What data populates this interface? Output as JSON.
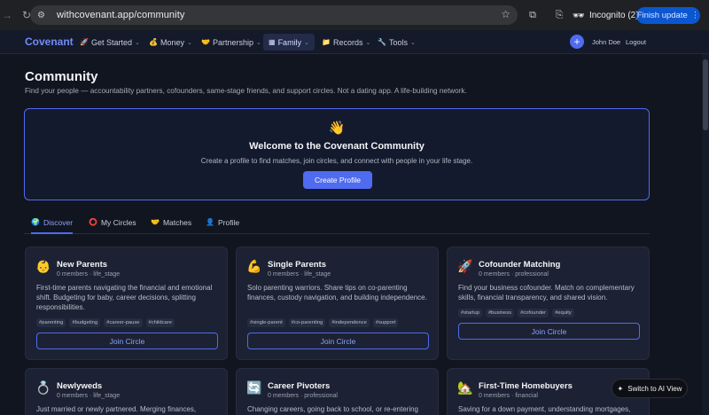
{
  "browser": {
    "url": "withcovenant.app/community",
    "profile_label": "Incognito (2)",
    "update_label": "Finish update"
  },
  "nav": {
    "brand": "Covenant",
    "items": [
      {
        "label": "Get Started",
        "icon": "🚀"
      },
      {
        "label": "Money",
        "icon": "💰"
      },
      {
        "label": "Partnership",
        "icon": "🤝"
      },
      {
        "label": "Family",
        "icon": "▦"
      },
      {
        "label": "Records",
        "icon": "📁"
      },
      {
        "label": "Tools",
        "icon": "🔧"
      }
    ],
    "active": "Family",
    "user_name": "John Doe",
    "logout_label": "Logout",
    "plus_label": "+"
  },
  "page": {
    "title": "Community",
    "subtitle": "Find your people — accountability partners, cofounders, same-stage friends, and support circles. Not a dating app. A life-building network."
  },
  "welcome": {
    "emoji": "👋",
    "title": "Welcome to the Covenant Community",
    "subtitle": "Create a profile to find matches, join circles, and connect with people in your life stage.",
    "button_label": "Create Profile"
  },
  "tabs": [
    {
      "label": "Discover",
      "icon": "🌍"
    },
    {
      "label": "My Circles",
      "icon": "⭕"
    },
    {
      "label": "Matches",
      "icon": "🤝"
    },
    {
      "label": "Profile",
      "icon": "👤"
    }
  ],
  "active_tab": "Discover",
  "circles": [
    {
      "icon": "👶",
      "name": "New Parents",
      "meta": "0 members · life_stage",
      "description": "First-time parents navigating the financial and emotional shift. Budgeting for baby, career decisions, splitting responsibilities.",
      "tags": [
        "#parenting",
        "#budgeting",
        "#career-pause",
        "#childcare"
      ],
      "button": "Join Circle"
    },
    {
      "icon": "💪",
      "name": "Single Parents",
      "meta": "0 members · life_stage",
      "description": "Solo parenting warriors. Share tips on co-parenting finances, custody navigation, and building independence.",
      "tags": [
        "#single-parent",
        "#co-parenting",
        "#independence",
        "#support"
      ],
      "button": "Join Circle"
    },
    {
      "icon": "🚀",
      "name": "Cofounder Matching",
      "meta": "0 members · professional",
      "description": "Find your business cofounder. Match on complementary skills, financial transparency, and shared vision.",
      "tags": [
        "#startup",
        "#business",
        "#cofounder",
        "#equity"
      ],
      "button": "Join Circle"
    },
    {
      "icon": "💍",
      "name": "Newlyweds",
      "meta": "0 members · life_stage",
      "description": "Just married or newly partnered. Merging finances,",
      "tags": [],
      "button": ""
    },
    {
      "icon": "🔄",
      "name": "Career Pivoters",
      "meta": "0 members · professional",
      "description": "Changing careers, going back to school, or re-entering",
      "tags": [],
      "button": ""
    },
    {
      "icon": "🏡",
      "name": "First-Time Homebuyers",
      "meta": "0 members · financial",
      "description": "Saving for a down payment, understanding mortgages,",
      "tags": [],
      "button": ""
    }
  ],
  "ai_view_label": "Switch to AI View"
}
